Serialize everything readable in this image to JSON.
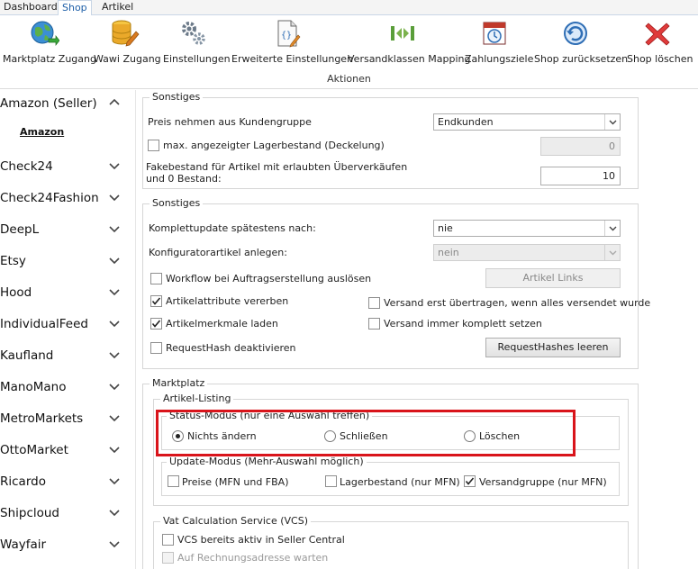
{
  "tabs": [
    {
      "label": "Dashboard",
      "active": false
    },
    {
      "label": "Shop",
      "active": true
    },
    {
      "label": "Artikel",
      "active": false
    }
  ],
  "ribbon": {
    "group_label": "Aktionen",
    "buttons": [
      {
        "label": "Marktplatz Zugang",
        "icon": "globe-icon"
      },
      {
        "label": "Wawi Zugang",
        "icon": "database-icon"
      },
      {
        "label": "Einstellungen",
        "icon": "gears-icon"
      },
      {
        "label": "Erweiterte Einstellungen",
        "icon": "document-code-icon"
      },
      {
        "label": "Versandklassen Mapping",
        "icon": "mapping-icon"
      },
      {
        "label": "Zahlungsziele",
        "icon": "calendar-clock-icon"
      },
      {
        "label": "Shop zurücksetzen",
        "icon": "reset-icon"
      },
      {
        "label": "Shop löschen",
        "icon": "delete-icon"
      }
    ]
  },
  "sidebar": {
    "items": [
      {
        "label": "Amazon (Seller)",
        "expanded": true
      },
      {
        "label": "Check24",
        "expanded": false
      },
      {
        "label": "Check24Fashion",
        "expanded": false
      },
      {
        "label": "DeepL",
        "expanded": false
      },
      {
        "label": "Etsy",
        "expanded": false
      },
      {
        "label": "Hood",
        "expanded": false
      },
      {
        "label": "IndividualFeed",
        "expanded": false
      },
      {
        "label": "Kaufland",
        "expanded": false
      },
      {
        "label": "ManoMano",
        "expanded": false
      },
      {
        "label": "MetroMarkets",
        "expanded": false
      },
      {
        "label": "OttoMarket",
        "expanded": false
      },
      {
        "label": "Ricardo",
        "expanded": false
      },
      {
        "label": "Shipcloud",
        "expanded": false
      },
      {
        "label": "Wayfair",
        "expanded": false
      }
    ],
    "subitem": "Amazon"
  },
  "sonstiges1": {
    "legend": "Sonstiges",
    "price_group_label": "Preis nehmen aus Kundengruppe",
    "price_group_value": "Endkunden",
    "max_stock_label": "max. angezeigter Lagerbestand (Deckelung)",
    "max_stock_value": "0",
    "fake_stock_label_1": "Fakebestand für Artikel mit erlaubten Überverkäufen",
    "fake_stock_label_2": "und 0 Bestand:",
    "fake_stock_value": "10"
  },
  "sonstiges2": {
    "legend": "Sonstiges",
    "full_update_label": "Komplettupdate spätestens nach:",
    "full_update_value": "nie",
    "configurator_label": "Konfiguratorartikel anlegen:",
    "configurator_value": "nein",
    "workflow_label": "Workflow bei Auftragserstellung auslösen",
    "artikel_links_button": "Artikel Links",
    "attr_inherit_label": "Artikelattribute vererben",
    "attr_inherit_checked": true,
    "ship_first_label": "Versand erst übertragen, wenn alles versendet wurde",
    "features_load_label": "Artikelmerkmale laden",
    "features_load_checked": true,
    "ship_complete_label": "Versand immer komplett setzen",
    "requesthash_label": "RequestHash deaktivieren",
    "requesthash_button": "RequestHashes leeren"
  },
  "marktplatz": {
    "legend": "Marktplatz",
    "listing_legend": "Artikel-Listing",
    "status_legend": "Status-Modus (nur eine Auswahl treffen)",
    "status_options": [
      {
        "label": "Nichts ändern",
        "selected": true
      },
      {
        "label": "Schließen",
        "selected": false
      },
      {
        "label": "Löschen",
        "selected": false
      }
    ],
    "update_legend": "Update-Modus (Mehr-Auswahl möglich)",
    "update_options": [
      {
        "label": "Preise (MFN und FBA)",
        "checked": false
      },
      {
        "label": "Lagerbestand (nur MFN)",
        "checked": false
      },
      {
        "label": "Versandgruppe (nur MFN)",
        "checked": true
      }
    ],
    "vcs_legend": "Vat Calculation Service (VCS)",
    "vcs_active_label": "VCS bereits aktiv in Seller Central",
    "vcs_wait_label": "Auf Rechnungsadresse warten"
  },
  "colors": {
    "accent": "#1e5fa8",
    "highlight": "#d9141b"
  }
}
